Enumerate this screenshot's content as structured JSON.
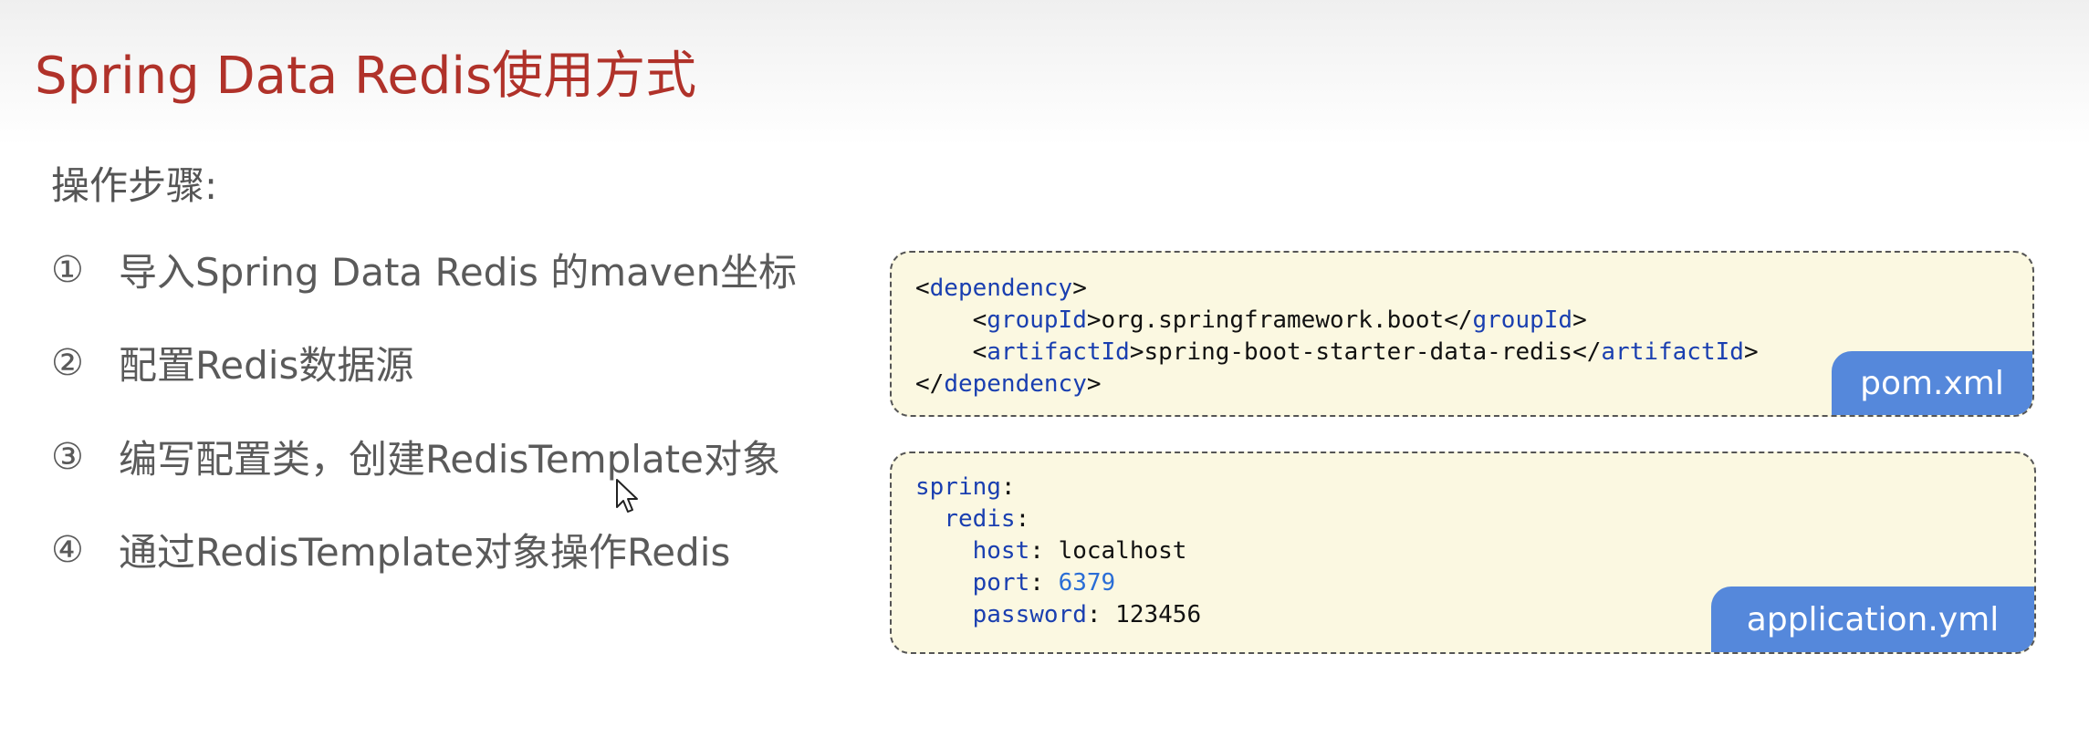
{
  "slide": {
    "title": "Spring Data Redis使用方式",
    "steps_heading": "操作步骤:",
    "steps": [
      {
        "num": "①",
        "text": "导入Spring Data Redis 的maven坐标"
      },
      {
        "num": "②",
        "text": "配置Redis数据源"
      },
      {
        "num": "③",
        "text": "编写配置类，创建RedisTemplate对象"
      },
      {
        "num": "④",
        "text": "通过RedisTemplate对象操作Redis"
      }
    ]
  },
  "pom_box": {
    "label": "pom.xml",
    "lines": [
      {
        "a": "<",
        "b": "dependency",
        "c": ">",
        "d": "",
        "e": "",
        "f": ""
      },
      {
        "a": "    <",
        "b": "groupId",
        "c": ">org.springframework.boot</",
        "d": "groupId",
        "e": ">",
        "f": ""
      },
      {
        "a": "    <",
        "b": "artifactId",
        "c": ">spring-boot-starter-data-redis</",
        "d": "artifactId",
        "e": ">",
        "f": ""
      },
      {
        "a": "</",
        "b": "dependency",
        "c": ">",
        "d": "",
        "e": "",
        "f": ""
      }
    ]
  },
  "yml_box": {
    "label": "application.yml",
    "lines": [
      {
        "indent": "",
        "key": "spring",
        "sep": ":",
        "value": "",
        "value_is_number": false
      },
      {
        "indent": "  ",
        "key": "redis",
        "sep": ":",
        "value": "",
        "value_is_number": false
      },
      {
        "indent": "    ",
        "key": "host",
        "sep": ": ",
        "value": "localhost",
        "value_is_number": false
      },
      {
        "indent": "    ",
        "key": "port",
        "sep": ": ",
        "value": "6379",
        "value_is_number": true
      },
      {
        "indent": "    ",
        "key": "password",
        "sep": ": ",
        "value": "123456",
        "value_is_number": false
      }
    ]
  },
  "colors": {
    "title": "#b0322a",
    "code_keyword": "#1a3fb0",
    "code_number": "#2a6dd6",
    "label_bg": "#5588db",
    "box_bg": "#fbf8e1"
  },
  "icons": {
    "cursor": "mouse-pointer-icon"
  }
}
